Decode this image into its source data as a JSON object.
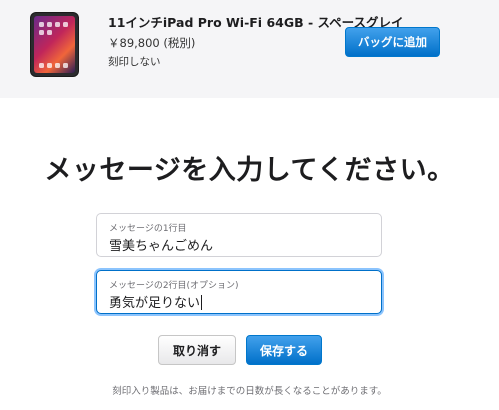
{
  "product": {
    "image_icon": "ipad-pro-image",
    "title": "11インチiPad Pro Wi-Fi 64GB - スペースグレイ",
    "price": "￥89,800 (税別)",
    "engraving_status": "刻印しない",
    "add_to_bag_label": "バッグに追加"
  },
  "engraving": {
    "heading": "メッセージを入力してください。",
    "line1": {
      "label": "メッセージの1行目",
      "value": "雪美ちゃんごめん"
    },
    "line2": {
      "label": "メッセージの2行目(オプション)",
      "value": "勇気が足りない"
    },
    "cancel_label": "取り消す",
    "save_label": "保存する",
    "footnote": "刻印入り製品は、お届けまでの日数が長くなることがあります。"
  },
  "colors": {
    "accent": "#0070c9",
    "top_bar_bg": "#f5f5f7"
  }
}
